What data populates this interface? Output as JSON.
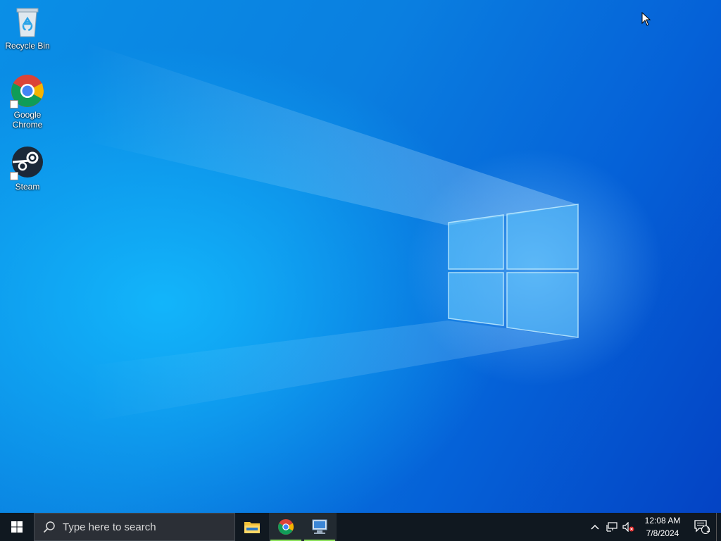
{
  "desktop": {
    "icons": [
      {
        "label": "Recycle Bin",
        "icon": "recycle-bin-icon"
      },
      {
        "label": "Google\nChrome",
        "icon": "chrome-icon"
      },
      {
        "label": "Steam",
        "icon": "steam-icon"
      }
    ],
    "wallpaper": {
      "logo": "windows-logo",
      "colors": {
        "light": "#19c0ff",
        "mid": "#0a7fe0",
        "dark": "#0443c4"
      }
    }
  },
  "taskbar": {
    "start_icon": "windows-start-icon",
    "search": {
      "placeholder": "Type here to search",
      "icon": "search-icon"
    },
    "apps": [
      {
        "name": "File Explorer",
        "icon": "file-explorer-icon",
        "running": false
      },
      {
        "name": "Google Chrome",
        "icon": "chrome-icon",
        "running": true
      },
      {
        "name": "Remote Desktop",
        "icon": "remote-desktop-icon",
        "running": true
      }
    ],
    "tray": {
      "icons": [
        "chevron-up-icon",
        "network-icon",
        "volume-muted-icon"
      ],
      "time": "12:08 AM",
      "date": "7/8/2024",
      "notification_count": "1"
    }
  }
}
